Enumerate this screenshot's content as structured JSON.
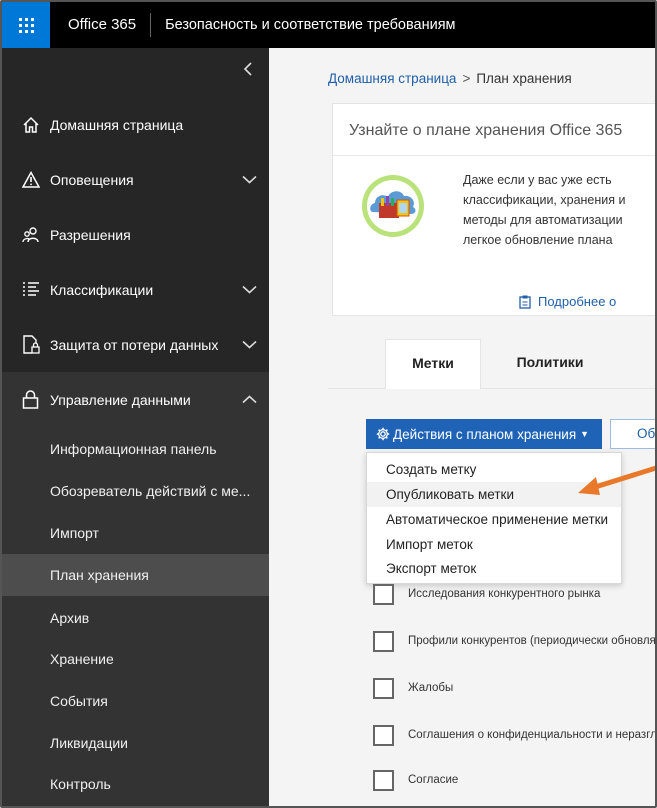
{
  "header": {
    "brand": "Office 365",
    "app_title": "Безопасность и соответствие требованиям"
  },
  "sidebar": {
    "items": [
      {
        "label": "Домашняя страница",
        "icon": "home-icon"
      },
      {
        "label": "Оповещения",
        "icon": "warning-icon",
        "expandable": true
      },
      {
        "label": "Разрешения",
        "icon": "people-icon"
      },
      {
        "label": "Классификации",
        "icon": "list-icon",
        "expandable": true
      },
      {
        "label": "Защита от потери данных",
        "icon": "document-lock-icon",
        "expandable": true
      },
      {
        "label": "Управление данными",
        "icon": "lock-icon",
        "expanded": true
      }
    ],
    "subitems": [
      {
        "label": "Информационная панель"
      },
      {
        "label": "Обозреватель действий с ме..."
      },
      {
        "label": "Импорт"
      },
      {
        "label": "План хранения",
        "active": true
      },
      {
        "label": "Архив"
      },
      {
        "label": "Хранение"
      },
      {
        "label": "События"
      },
      {
        "label": "Ликвидации"
      },
      {
        "label": "Контроль"
      }
    ]
  },
  "breadcrumb": {
    "home": "Домашняя страница",
    "separator": ">",
    "current": "План хранения"
  },
  "card": {
    "title": "Узнайте о плане хранения Office 365",
    "text_lines": [
      "Даже если у вас уже есть",
      "классификации, хранения и",
      "методы для автоматизации",
      "легкое обновление плана"
    ],
    "link": "Подробнее о"
  },
  "tabs": [
    {
      "label": "Метки",
      "active": true
    },
    {
      "label": "Политики",
      "active": false
    }
  ],
  "actions": {
    "button_label": "Действия с планом хранения",
    "second_button_label": "Об",
    "menu": [
      {
        "label": "Создать метку"
      },
      {
        "label": "Опубликовать метки",
        "highlighted": true
      },
      {
        "label": "Автоматическое применение метки"
      },
      {
        "label": "Импорт меток"
      },
      {
        "label": "Экспорт меток"
      }
    ]
  },
  "rows": [
    {
      "label": "Исследования конкурентного рынка"
    },
    {
      "label": "Профили конкурентов (периодически обновля"
    },
    {
      "label": "Жалобы"
    },
    {
      "label": "Соглашения о конфиденциальности и неразгл"
    },
    {
      "label": "Согласие"
    }
  ],
  "colors": {
    "accent": "#0078d7",
    "primary_button": "#1f63b6",
    "link": "#1f5fa8",
    "sidebar_bg": "#262626",
    "callout_arrow": "#e8782a"
  }
}
